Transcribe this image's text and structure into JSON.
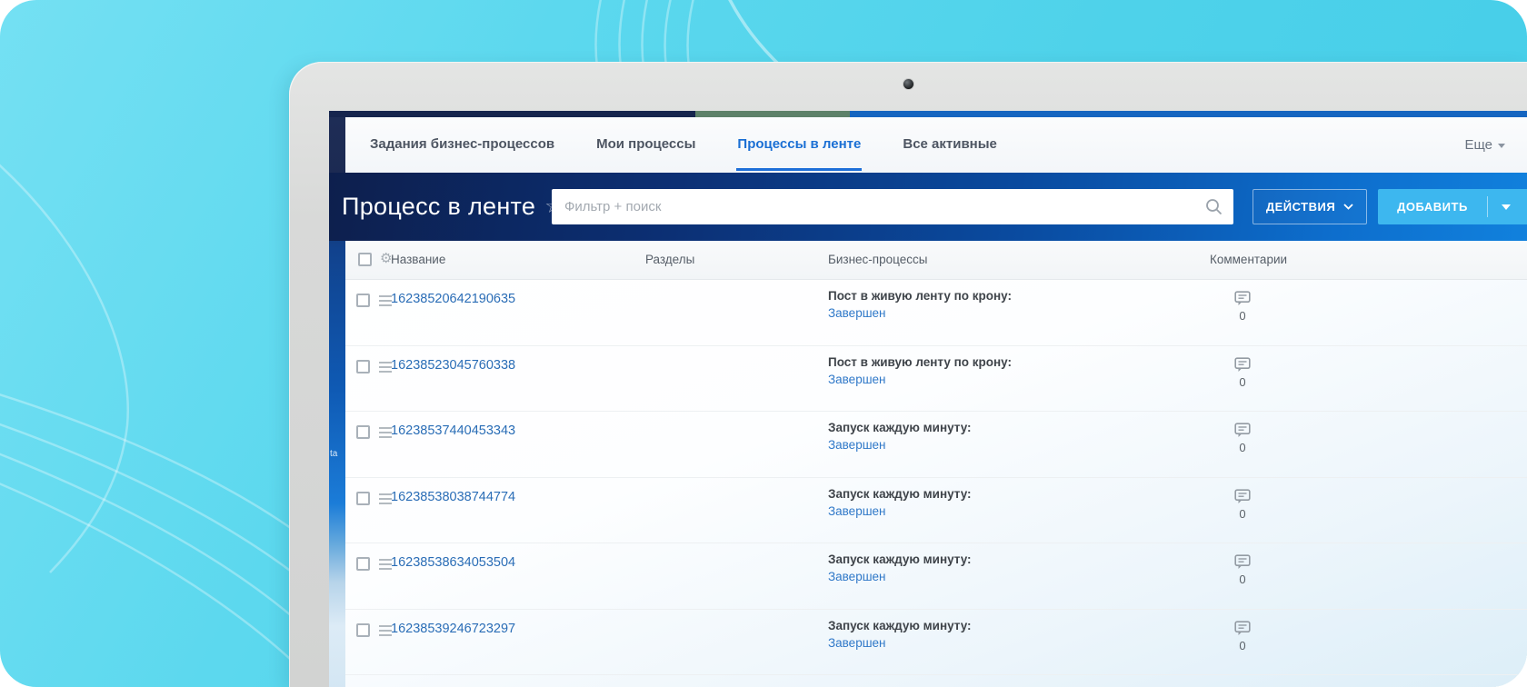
{
  "device": {
    "camera_icon": "camera-dot"
  },
  "tabs": {
    "items": [
      {
        "label": "Задания бизнес-процессов",
        "active": false
      },
      {
        "label": "Мои процессы",
        "active": false
      },
      {
        "label": "Процессы в ленте",
        "active": true
      },
      {
        "label": "Все активные",
        "active": false
      }
    ],
    "more_label": "Еще"
  },
  "header": {
    "title": "Процесс в ленте",
    "favorite_icon": "star-outline",
    "search_placeholder": "Фильтр + поиск",
    "actions_label": "ДЕЙСТВИЯ",
    "add_label": "ДОБАВИТЬ"
  },
  "left_strip_fragment": "ta",
  "table": {
    "columns": [
      "Название",
      "Разделы",
      "Бизнес-процессы",
      "Комментарии"
    ],
    "rows": [
      {
        "id": "16238520642190635",
        "sections": "",
        "process": "Пост в живую ленту по крону:",
        "status": "Завершен",
        "comments": "0"
      },
      {
        "id": "16238523045760338",
        "sections": "",
        "process": "Пост в живую ленту по крону:",
        "status": "Завершен",
        "comments": "0"
      },
      {
        "id": "16238537440453343",
        "sections": "",
        "process": "Запуск каждую минуту:",
        "status": "Завершен",
        "comments": "0"
      },
      {
        "id": "16238538038744774",
        "sections": "",
        "process": "Запуск каждую минуту:",
        "status": "Завершен",
        "comments": "0"
      },
      {
        "id": "16238538634053504",
        "sections": "",
        "process": "Запуск каждую минуту:",
        "status": "Завершен",
        "comments": "0"
      },
      {
        "id": "16238539246723297",
        "sections": "",
        "process": "Запуск каждую минуту:",
        "status": "Завершен",
        "comments": "0"
      }
    ]
  },
  "colors": {
    "background_cyan": "#55d4ec",
    "top_strip_navy": "#16254e",
    "top_strip_green": "#5d8169",
    "top_strip_blue": "#1565c0",
    "header_gradient_start": "#0d1f4d",
    "header_gradient_end": "#1181dd",
    "active_tab_blue": "#1e6fd8",
    "add_button_blue": "#3db7ef",
    "link_blue": "#2a6db6",
    "status_link_blue": "#2f78c8"
  }
}
